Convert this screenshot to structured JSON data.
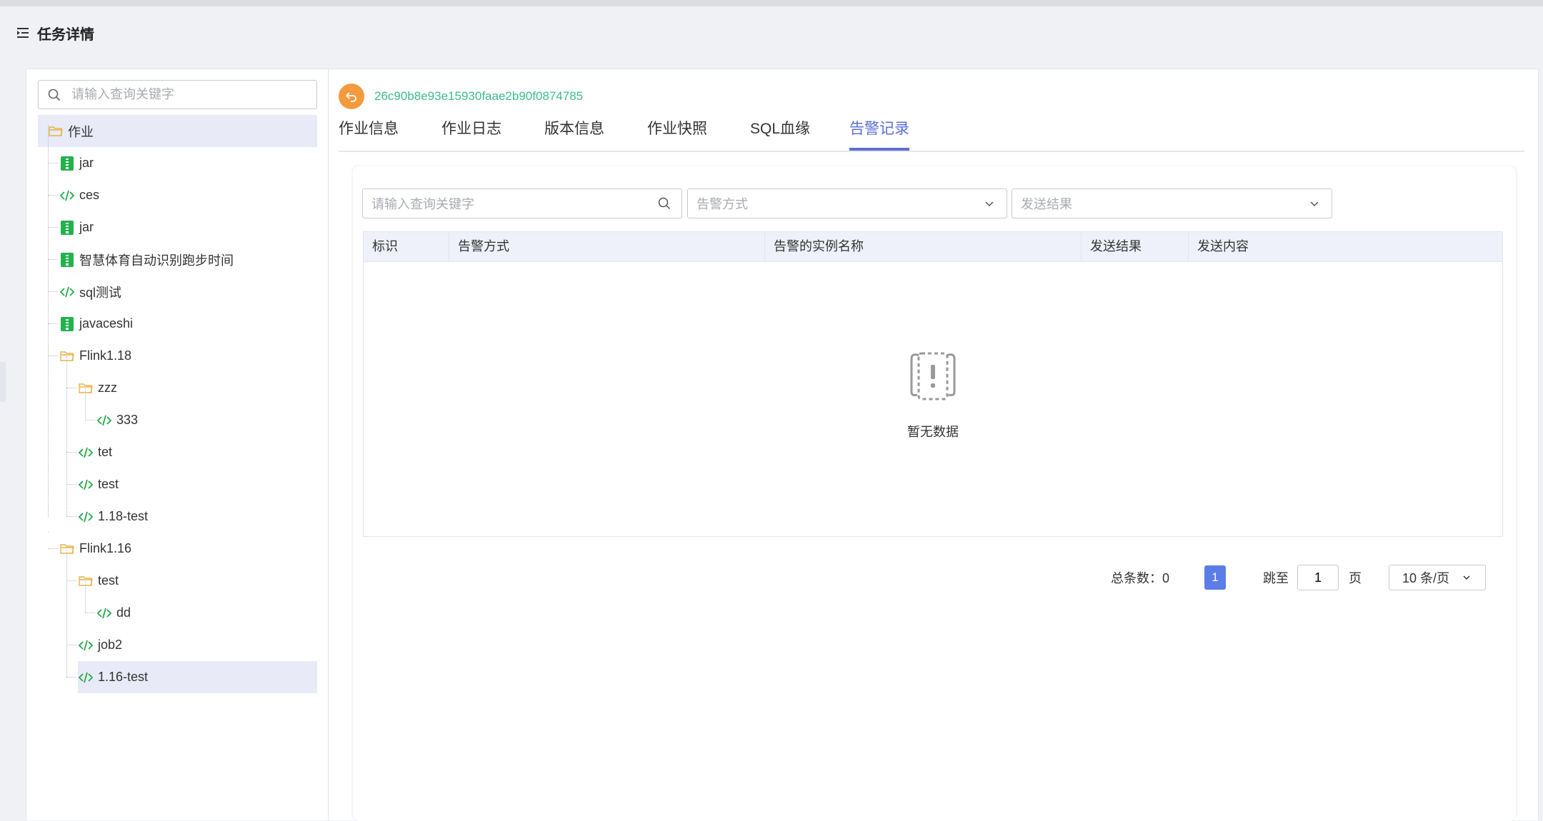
{
  "header": {
    "title": "任务详情"
  },
  "tree": {
    "search_placeholder": "请输入查询关键字",
    "nodes": [
      {
        "label": "作业",
        "type": "folder"
      },
      {
        "label": "jar",
        "type": "jar"
      },
      {
        "label": "ces",
        "type": "sql"
      },
      {
        "label": "jar",
        "type": "jar"
      },
      {
        "label": "智慧体育自动识别跑步时间",
        "type": "jar"
      },
      {
        "label": "sql测试",
        "type": "sql"
      },
      {
        "label": "javaceshi",
        "type": "jar"
      },
      {
        "label": "Flink1.18",
        "type": "folder"
      },
      {
        "label": "zzz",
        "type": "folder"
      },
      {
        "label": "333",
        "type": "sql"
      },
      {
        "label": "tet",
        "type": "sql"
      },
      {
        "label": "test",
        "type": "sql"
      },
      {
        "label": "1.18-test",
        "type": "sql"
      },
      {
        "label": "Flink1.16",
        "type": "folder"
      },
      {
        "label": "test",
        "type": "folder"
      },
      {
        "label": "dd",
        "type": "sql"
      },
      {
        "label": "job2",
        "type": "sql"
      },
      {
        "label": "1.16-test",
        "type": "sql"
      }
    ]
  },
  "job": {
    "id": "26c90b8e93e15930faae2b90f0874785"
  },
  "tabs": [
    {
      "label": "作业信息"
    },
    {
      "label": "作业日志"
    },
    {
      "label": "版本信息"
    },
    {
      "label": "作业快照"
    },
    {
      "label": "SQL血缘"
    },
    {
      "label": "告警记录"
    }
  ],
  "filters": {
    "keyword_placeholder": "请输入查询关键字",
    "alert_method_placeholder": "告警方式",
    "send_result_placeholder": "发送结果"
  },
  "table": {
    "columns": [
      "标识",
      "告警方式",
      "告警的实例名称",
      "发送结果",
      "发送内容"
    ],
    "empty_text": "暂无数据"
  },
  "pagination": {
    "total_label": "总条数：0",
    "current_page": "1",
    "jump_label": "跳至",
    "jump_value": "1",
    "page_suffix": "页",
    "page_size": "10 条/页"
  },
  "colors": {
    "accent": "#5b6fd6",
    "job_id": "#3dbb8a",
    "back_button": "#f39a3d",
    "jar_icon": "#22b24c",
    "sql_icon": "#22a94a",
    "folder_icon": "#e8b24a"
  }
}
